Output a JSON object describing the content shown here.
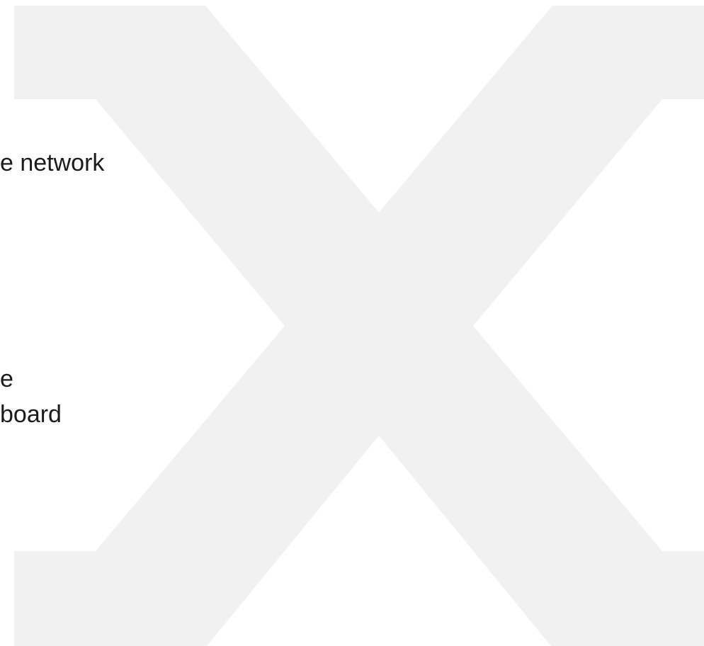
{
  "watermark": {
    "icon": "x-logo-icon",
    "color": "#f1f1f2"
  },
  "text_lines": [
    "e network",
    "e",
    "board"
  ]
}
